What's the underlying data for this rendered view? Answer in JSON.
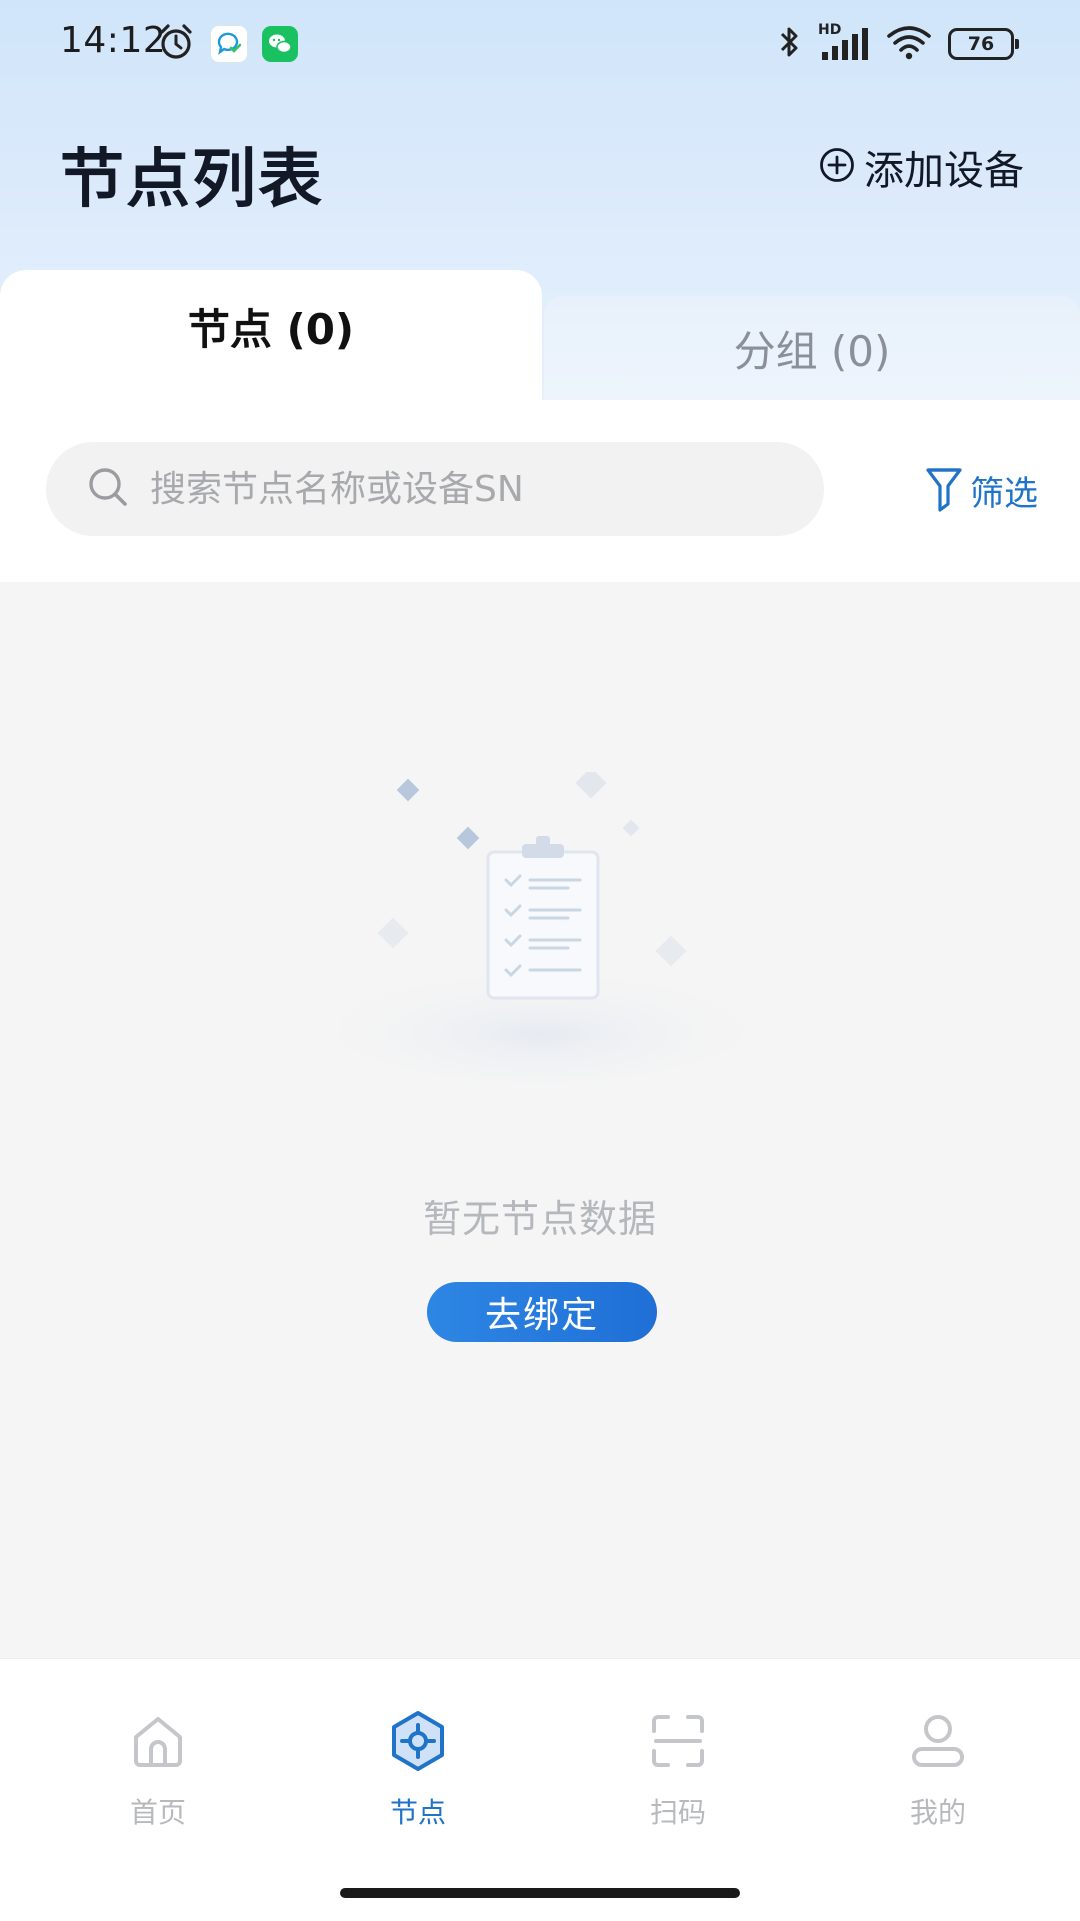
{
  "status_bar": {
    "time": "14:12",
    "battery": "76",
    "network_label": "HD"
  },
  "header": {
    "title": "节点列表",
    "add_device_label": "添加设备"
  },
  "tabs": [
    {
      "label": "节点 (0)",
      "active": true
    },
    {
      "label": "分组 (0)",
      "active": false
    }
  ],
  "search": {
    "placeholder": "搜索节点名称或设备SN",
    "value": ""
  },
  "filter": {
    "label": "筛选"
  },
  "empty_state": {
    "message": "暂无节点数据",
    "action_label": "去绑定"
  },
  "bottom_nav": [
    {
      "label": "首页",
      "icon": "home-icon",
      "active": false
    },
    {
      "label": "节点",
      "icon": "node-icon",
      "active": true
    },
    {
      "label": "扫码",
      "icon": "scan-icon",
      "active": false
    },
    {
      "label": "我的",
      "icon": "profile-icon",
      "active": false
    }
  ],
  "colors": {
    "accent": "#1f73c8",
    "button_gradient_start": "#2e86e4",
    "button_gradient_end": "#1f6fd6",
    "header_bg": "#d0e5fa",
    "inactive_text": "#b7b9bd"
  }
}
